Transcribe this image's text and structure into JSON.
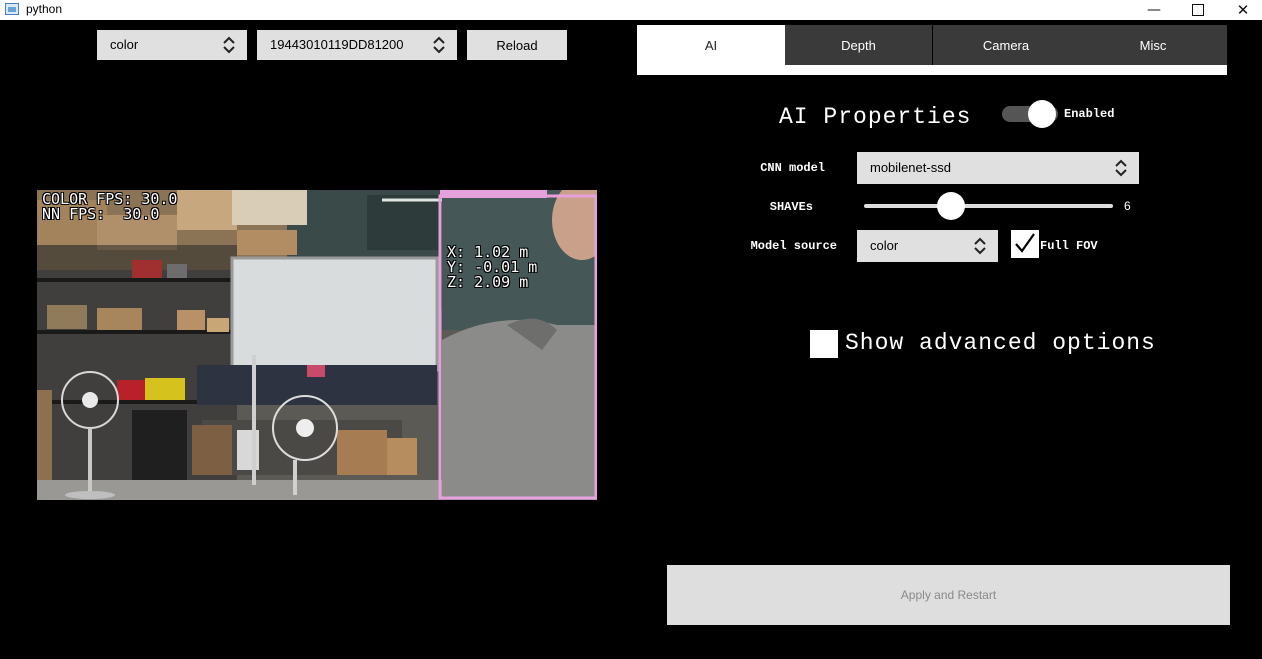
{
  "window": {
    "title": "python",
    "minimize": "—",
    "close": "✕"
  },
  "source": {
    "camera_select": "color",
    "device_select": "19443010119DD81200",
    "reload_label": "Reload"
  },
  "overlay": {
    "fps_line1": "COLOR FPS: 30.0",
    "fps_line2": "NN FPS:  30.0",
    "x": "X: 1.02 m",
    "y": "Y: -0.01 m",
    "z": "Z: 2.09 m",
    "bbox_color": "#e6a1dd"
  },
  "tabs": [
    {
      "label": "AI",
      "active": true
    },
    {
      "label": "Depth",
      "active": false
    },
    {
      "label": "Camera",
      "active": false
    },
    {
      "label": "Misc",
      "active": false
    }
  ],
  "ai": {
    "heading": "AI Properties",
    "enabled_label": "Enabled",
    "enabled": true,
    "cnn_label": "CNN model",
    "cnn_value": "mobilenet-ssd",
    "shaves_label": "SHAVEs",
    "shaves_value": "6",
    "shaves_min": 1,
    "shaves_max": 16,
    "model_source_label": "Model source",
    "model_source_value": "color",
    "full_fov_label": "Full FOV",
    "full_fov_checked": true,
    "advanced_label": "Show advanced options",
    "advanced_checked": false
  },
  "footer": {
    "apply_label": "Apply and Restart"
  }
}
